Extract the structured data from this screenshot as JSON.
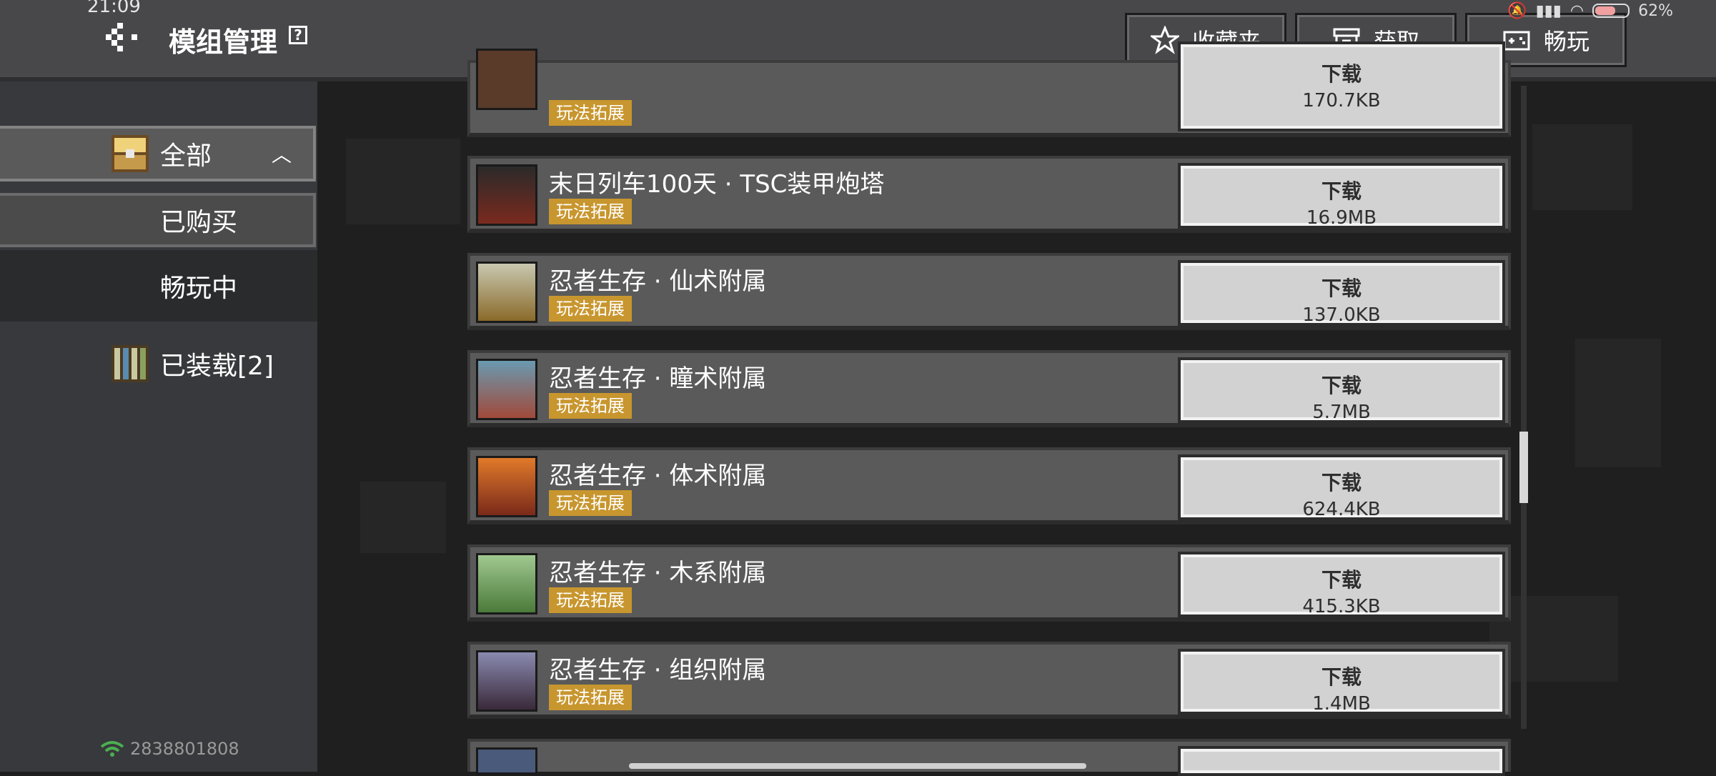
{
  "status": {
    "time": "21:09",
    "battery": "62%"
  },
  "header": {
    "title": "模组管理",
    "help": "?",
    "buttons": [
      {
        "label": "收藏夹",
        "icon": "star-icon"
      },
      {
        "label": "获取",
        "icon": "archive-icon"
      },
      {
        "label": "畅玩",
        "icon": "gamepad-icon"
      }
    ]
  },
  "sidebar": {
    "items": [
      {
        "label": "全部",
        "icon": "chest-icon",
        "expanded": true
      },
      {
        "label": "已购买"
      },
      {
        "label": "畅玩中"
      },
      {
        "label": "已装载[2]",
        "icon": "bookshelf-icon"
      }
    ],
    "network_id": "2838801808"
  },
  "list": {
    "download_label": "下载",
    "tag_label": "玩法拓展",
    "items": [
      {
        "title": "",
        "size": "170.7KB",
        "thumb_color": "#5a3b2a"
      },
      {
        "title": "末日列车100天 · TSC装甲炮塔",
        "size": "16.9MB",
        "thumb_color": "#3b2a24"
      },
      {
        "title": "忍者生存 · 仙术附属",
        "size": "137.0KB",
        "thumb_color": "#8a7a3a"
      },
      {
        "title": "忍者生存 · 瞳术附属",
        "size": "5.7MB",
        "thumb_color": "#5c7a6a"
      },
      {
        "title": "忍者生存 · 体术附属",
        "size": "624.4KB",
        "thumb_color": "#b6442a"
      },
      {
        "title": "忍者生存 · 木系附属",
        "size": "415.3KB",
        "thumb_color": "#6a9a5a"
      },
      {
        "title": "忍者生存 · 组织附属",
        "size": "1.4MB",
        "thumb_color": "#4a3a5a"
      }
    ]
  }
}
